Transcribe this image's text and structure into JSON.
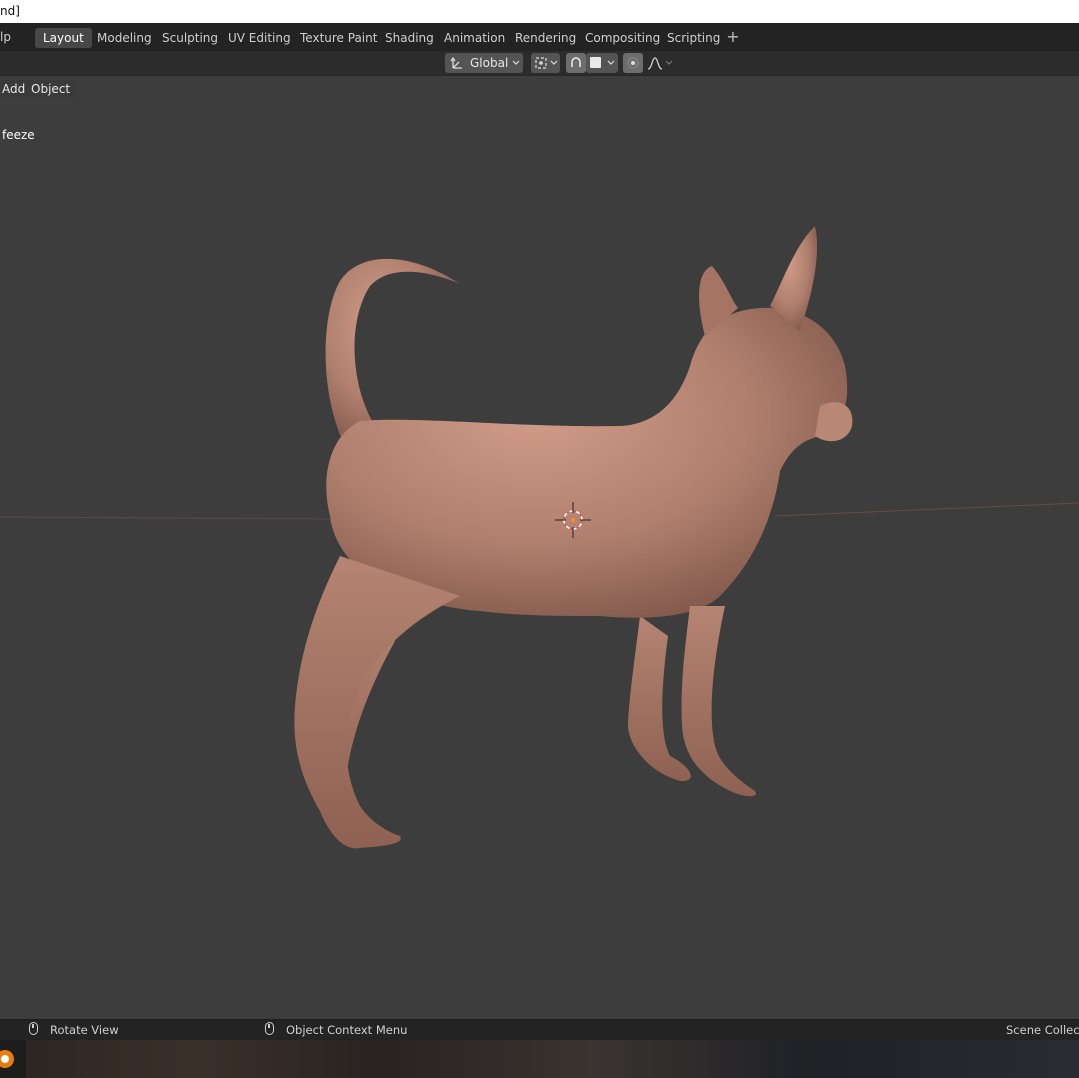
{
  "window": {
    "title_fragment": "nd]"
  },
  "topbar": {
    "menu_fragment": "lp",
    "tabs": [
      "Layout",
      "Modeling",
      "Sculpting",
      "UV Editing",
      "Texture Paint",
      "Shading",
      "Animation",
      "Rendering",
      "Compositing",
      "Scripting"
    ],
    "active_tab": "Layout",
    "add_tab": "+"
  },
  "header": {
    "orientation_label": "Global",
    "icons": [
      "transform-orientation-icon",
      "pivot-point-icon",
      "snap-icon",
      "snap-element-icon",
      "proportional-edit-icon",
      "falloff-curve-icon"
    ]
  },
  "viewport": {
    "menus": [
      "Add",
      "Object"
    ],
    "object_label": "feeze",
    "model": "chihuahua-sculpt",
    "colors": {
      "background": "#3d3d3d",
      "model_skin": "#b07f6e",
      "cursor_red": "#e0524a"
    }
  },
  "statusbar": {
    "left_hint": "Rotate View",
    "middle_hint": "Object Context Menu",
    "right_fragment": "Scene Collectio"
  }
}
